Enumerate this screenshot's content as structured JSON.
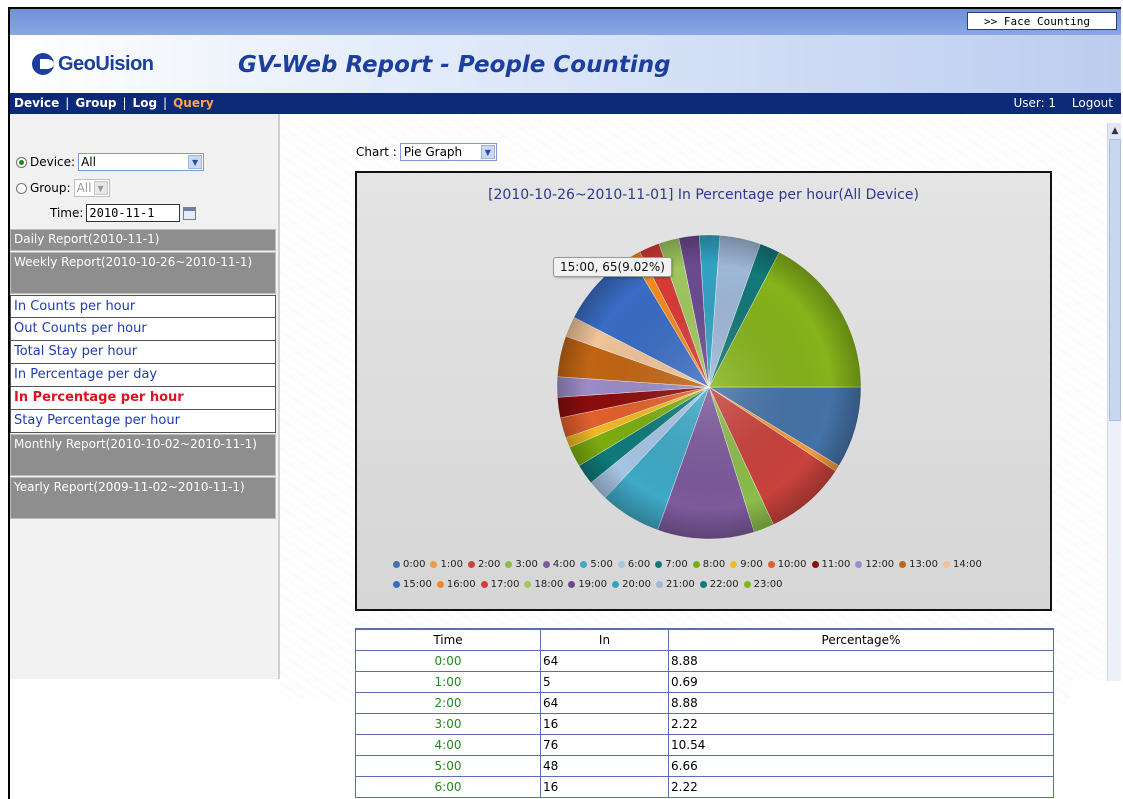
{
  "face_counting_button": ">> Face Counting",
  "logo_text": "GeoUision",
  "app_title": "GV-Web Report - People Counting",
  "nav": {
    "device": "Device",
    "group": "Group",
    "log": "Log",
    "query": "Query",
    "sep": "|",
    "user": "User: 1",
    "logout": "Logout"
  },
  "sidebar": {
    "device_label": "Device:",
    "device_value": "All",
    "group_label": "Group:",
    "group_value": "All",
    "time_label": "Time:",
    "time_value": "2010-11-1",
    "daily": "Daily Report(2010-11-1)",
    "weekly": "Weekly Report(2010-10-26~2010-11-1)",
    "weekly_items": [
      "In Counts per hour",
      "Out Counts per hour",
      "Total Stay per hour",
      "In Percentage per day",
      "In Percentage per hour",
      "Stay Percentage per hour"
    ],
    "monthly": "Monthly Report(2010-10-02~2010-11-1)",
    "yearly": "Yearly Report(2009-11-02~2010-11-1)"
  },
  "chart_selector": {
    "label": "Chart :",
    "value": "Pie Graph"
  },
  "colors": {
    "nav_bg": "#0d2a78",
    "active_link": "#e0121f",
    "query_link": "#ffa54a"
  },
  "table": {
    "headers": [
      "Time",
      "In",
      "Percentage%"
    ],
    "rows": [
      [
        "0:00",
        "64",
        "8.88"
      ],
      [
        "1:00",
        "5",
        "0.69"
      ],
      [
        "2:00",
        "64",
        "8.88"
      ],
      [
        "3:00",
        "16",
        "2.22"
      ],
      [
        "4:00",
        "76",
        "10.54"
      ],
      [
        "5:00",
        "48",
        "6.66"
      ],
      [
        "6:00",
        "16",
        "2.22"
      ]
    ]
  },
  "chart_data": {
    "type": "pie",
    "title": "[2010-10-26~2010-11-01] In Percentage per hour(All Device)",
    "tooltip": "15:00, 65(9.02%)",
    "legend_placement": "bottom",
    "categories": [
      "0:00",
      "1:00",
      "2:00",
      "3:00",
      "4:00",
      "5:00",
      "6:00",
      "7:00",
      "8:00",
      "9:00",
      "10:00",
      "11:00",
      "12:00",
      "13:00",
      "14:00",
      "15:00",
      "16:00",
      "17:00",
      "18:00",
      "19:00",
      "20:00",
      "21:00",
      "22:00",
      "23:00"
    ],
    "values": [
      64,
      5,
      64,
      16,
      76,
      48,
      16,
      16,
      16,
      8,
      16,
      16,
      16,
      32,
      16,
      65,
      8,
      16,
      16,
      16,
      16,
      32,
      16,
      128
    ],
    "colors": [
      "#4572a7",
      "#f29a3b",
      "#c9423c",
      "#8bbd4a",
      "#7d5a9c",
      "#3fa9c6",
      "#a6c4e4",
      "#0f7a7a",
      "#7cad10",
      "#f1b821",
      "#e2602c",
      "#8b0d0d",
      "#9b8cc7",
      "#c26513",
      "#f0c49a",
      "#3a6cc4",
      "#f28b1e",
      "#d93a36",
      "#a0c860",
      "#6c4a91",
      "#32a3c3",
      "#9fb8d8",
      "#137979",
      "#86b31a"
    ]
  }
}
